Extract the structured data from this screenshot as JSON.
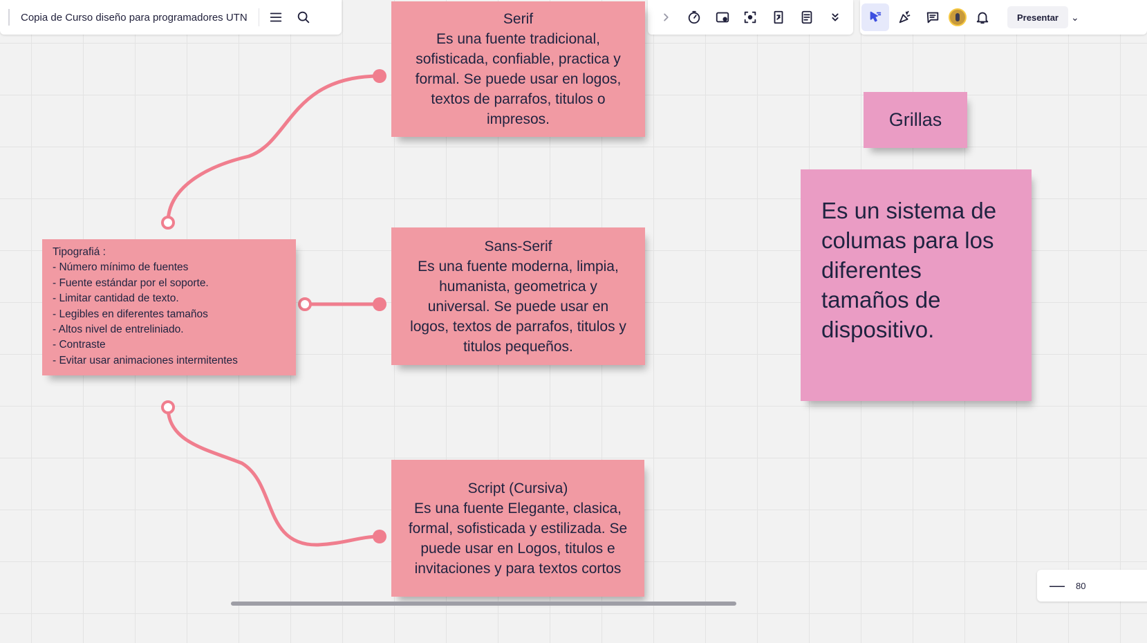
{
  "board": {
    "title": "Copia de Curso diseño para programadores UTN"
  },
  "toolbar": {
    "left_icons": [
      "menu-icon",
      "search-icon"
    ],
    "mid_icons": [
      "chevron-right-icon",
      "timer-icon",
      "screen-record-icon",
      "focus-icon",
      "countdown-icon",
      "notes-icon",
      "chevrons-down-icon"
    ],
    "right_icons": [
      "select-cursor-icon",
      "celebrate-icon",
      "comment-icon",
      "avatar",
      "bell-icon"
    ],
    "present_label": "Presentar"
  },
  "notes": {
    "serif": {
      "title": "Serif",
      "body": "Es una fuente tradicional, sofisticada, confiable, practica y formal. Se puede usar en logos, textos de parrafos, titulos o impresos."
    },
    "sans": {
      "title": "Sans-Serif",
      "body": "Es una fuente moderna, limpia, humanista, geometrica y universal. Se puede usar en logos, textos de parrafos, titulos y titulos pequeños."
    },
    "script": {
      "title": "Script (Cursiva)",
      "body": "Es una fuente Elegante, clasica, formal, sofisticada y estilizada. Se puede usar en Logos, titulos e invitaciones y para textos cortos"
    },
    "tipografia": {
      "lines": [
        "Tipografiá :",
        "- Número mínimo de fuentes",
        "- Fuente estándar por el soporte.",
        "- Limitar cantidad de texto.",
        "- Legibles en diferentes tamaños",
        "- Altos nivel de entreliniado.",
        "- Contraste",
        "- Evitar usar animaciones intermitentes"
      ]
    },
    "grillas_title": "Grillas",
    "grillas_body": "Es un sistema de columas para los diferentes tamaños de dispositivo."
  },
  "colors": {
    "note_pink": "#f19aa3",
    "note_magenta": "#ea9cc4",
    "connector": "#f07e8e",
    "accent": "#3d4fe0"
  },
  "zoom": {
    "value": "80"
  }
}
